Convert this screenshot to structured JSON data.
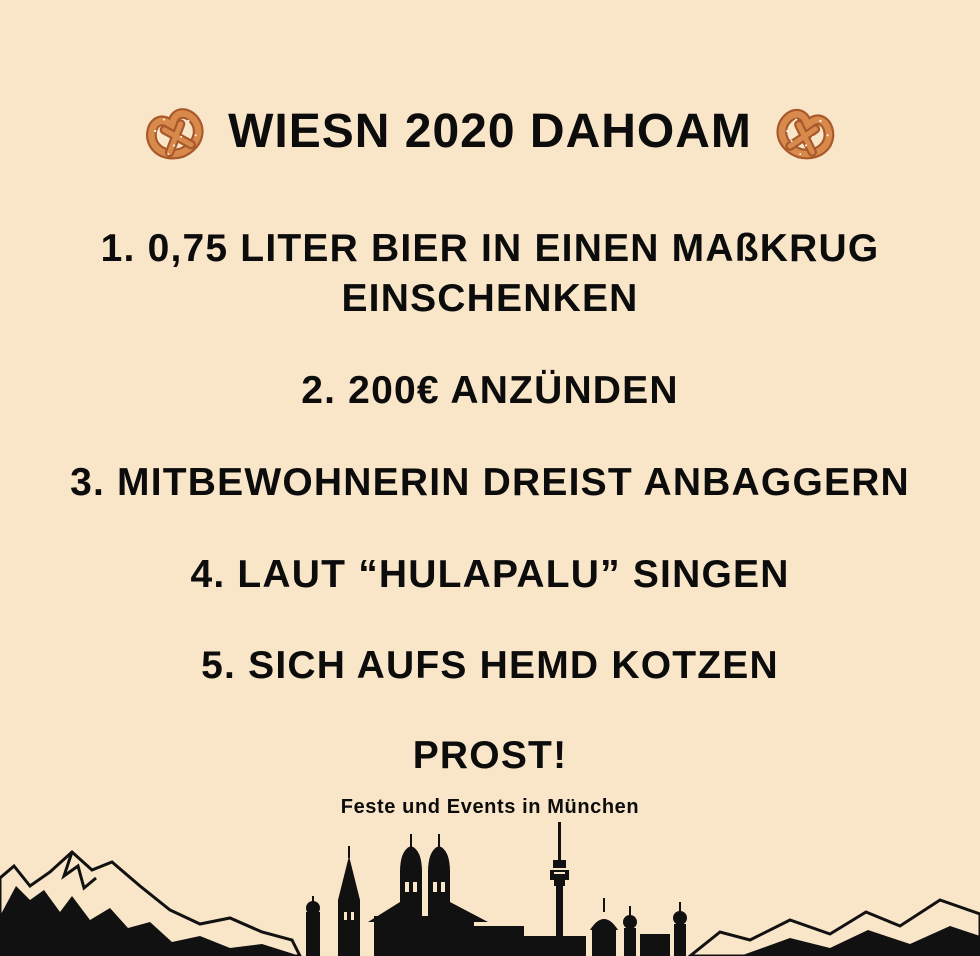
{
  "header": {
    "title": "WIESN 2020 DAHOAM",
    "left_icon": "pretzel-icon",
    "right_icon": "pretzel-icon"
  },
  "steps": [
    {
      "line1": "1. 0,75 LITER BIER IN EINEN MAßKRUG",
      "line2": "EINSCHENKEN"
    },
    {
      "line1": "2. 200€ ANZÜNDEN"
    },
    {
      "line1": "3. MITBEWOHNERIN DREIST ANBAGGERN"
    },
    {
      "line1": "4.  LAUT “HULAPALU” SINGEN"
    },
    {
      "line1": "5. SICH AUFS HEMD KOTZEN"
    }
  ],
  "closing": "PROST!",
  "footer": {
    "brand": "Feste und Events in München",
    "illustration": "munich-skyline-icon"
  },
  "colors": {
    "background": "#f9e6c8",
    "text": "#0c0c0c",
    "pretzel": "#c9733a"
  }
}
